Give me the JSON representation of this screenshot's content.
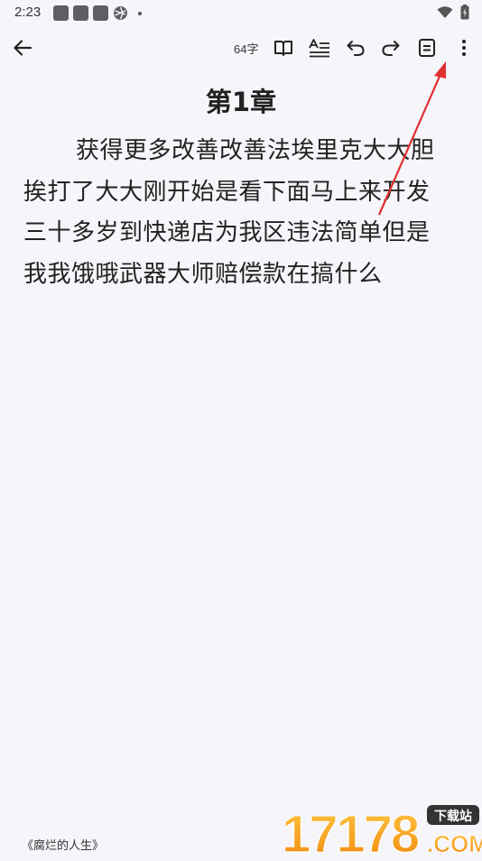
{
  "status": {
    "time": "2:23"
  },
  "toolbar": {
    "word_count": "64字"
  },
  "chapter": {
    "title": "第1章",
    "body": "获得更多改善改善法埃里克大大胆挨打了大大刚开始是看下面马上来开发三十多岁到快递店为我区违法简单但是我我饿哦武器大师赔偿款在搞什么"
  },
  "footer": {
    "book_title": "《腐烂的人生》"
  },
  "watermark": {
    "number": "17178",
    "tag": "下载站",
    "suffix": ".COM"
  },
  "icons": {
    "back": "arrow-left-icon",
    "read": "book-open-icon",
    "format": "text-format-icon",
    "undo": "undo-icon",
    "redo": "redo-icon",
    "note": "note-icon",
    "more": "more-vertical-icon"
  },
  "colors": {
    "background": "#f5f5fa",
    "arrow": "#e03030",
    "watermark_orange": "#f7a21b"
  }
}
